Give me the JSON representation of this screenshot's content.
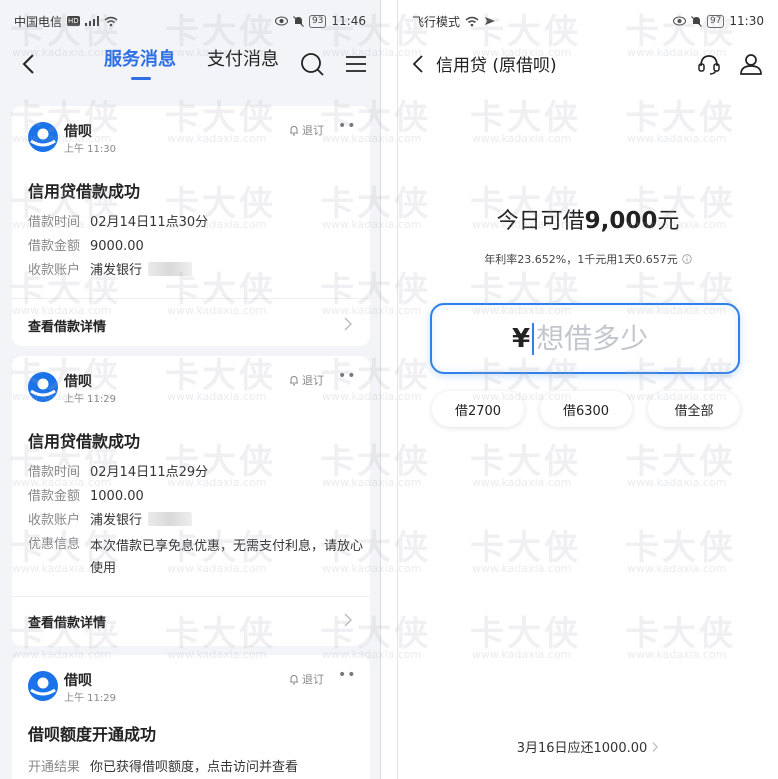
{
  "watermark": {
    "mark": "卡大侠",
    "url": "www.kadaxia.com"
  },
  "left": {
    "status": {
      "carrier": "中国电信",
      "network": "HD",
      "battery": "93",
      "time": "11:46"
    },
    "tabs": [
      {
        "label": "服务消息",
        "active": true
      },
      {
        "label": "支付消息",
        "active": false
      }
    ],
    "accent": "#2f6fe6",
    "messages": [
      {
        "sender": "借呗",
        "time": "上午 11:30",
        "subscribe": "退订",
        "title": "信用贷借款成功",
        "rows": [
          {
            "label": "借款时间",
            "value": "02月14日11点30分"
          },
          {
            "label": "借款金额",
            "value": "9000.00"
          },
          {
            "label": "收款账户",
            "value": "浦发银行"
          }
        ],
        "detail": "查看借款详情"
      },
      {
        "sender": "借呗",
        "time": "上午 11:29",
        "subscribe": "退订",
        "title": "信用贷借款成功",
        "rows": [
          {
            "label": "借款时间",
            "value": "02月14日11点29分"
          },
          {
            "label": "借款金额",
            "value": "1000.00"
          },
          {
            "label": "收款账户",
            "value": "浦发银行"
          },
          {
            "label": "优惠信息",
            "value": "本次借款已享免息优惠，无需支付利息，请放心使用"
          }
        ],
        "detail": "查看借款详情"
      },
      {
        "sender": "借呗",
        "time": "上午 11:29",
        "subscribe": "退订",
        "title": "借呗额度开通成功",
        "rows": [
          {
            "label": "开通结果",
            "value": "你已获得借呗额度，点击访问并查看"
          }
        ]
      }
    ]
  },
  "right": {
    "status": {
      "mode": "飞行模式",
      "battery": "97",
      "time": "11:30"
    },
    "title": "信用贷 (原借呗)",
    "limit_prefix": "今日可借",
    "limit_amount": "9,000",
    "limit_suffix": "元",
    "rate": "年利率23.652%，1千元用1天0.657元",
    "currency": "¥",
    "amount_placeholder": "想借多少",
    "quick_amounts": [
      "借2700",
      "借6300",
      "借全部"
    ],
    "repay": "3月16日应还1000.00",
    "accent": "#2f80e8"
  }
}
